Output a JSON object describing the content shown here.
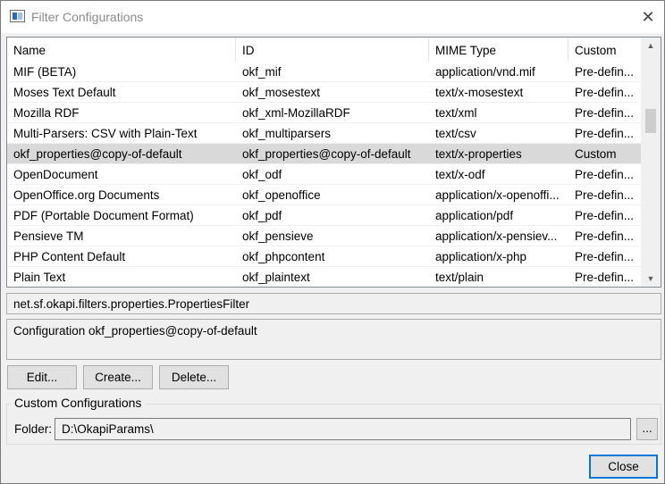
{
  "window": {
    "title": "Filter Configurations",
    "close_glyph": "✕"
  },
  "table": {
    "columns": [
      "Name",
      "ID",
      "MIME Type",
      "Custom"
    ],
    "rows": [
      {
        "name": "MIF (BETA)",
        "id": "okf_mif",
        "mime": "application/vnd.mif",
        "custom": "Pre-defin..."
      },
      {
        "name": "Moses Text Default",
        "id": "okf_mosestext",
        "mime": "text/x-mosestext",
        "custom": "Pre-defin..."
      },
      {
        "name": "Mozilla RDF",
        "id": "okf_xml-MozillaRDF",
        "mime": "text/xml",
        "custom": "Pre-defin..."
      },
      {
        "name": "Multi-Parsers: CSV with Plain-Text",
        "id": "okf_multiparsers",
        "mime": "text/csv",
        "custom": "Pre-defin..."
      },
      {
        "name": "okf_properties@copy-of-default",
        "id": "okf_properties@copy-of-default",
        "mime": "text/x-properties",
        "custom": "Custom",
        "selected": true
      },
      {
        "name": "OpenDocument",
        "id": "okf_odf",
        "mime": "text/x-odf",
        "custom": "Pre-defin..."
      },
      {
        "name": "OpenOffice.org Documents",
        "id": "okf_openoffice",
        "mime": "application/x-openoffi...",
        "custom": "Pre-defin..."
      },
      {
        "name": "PDF (Portable Document Format)",
        "id": "okf_pdf",
        "mime": "application/pdf",
        "custom": "Pre-defin..."
      },
      {
        "name": "Pensieve TM",
        "id": "okf_pensieve",
        "mime": "application/x-pensiev...",
        "custom": "Pre-defin..."
      },
      {
        "name": "PHP Content Default",
        "id": "okf_phpcontent",
        "mime": "application/x-php",
        "custom": "Pre-defin..."
      },
      {
        "name": "Plain Text",
        "id": "okf_plaintext",
        "mime": "text/plain",
        "custom": "Pre-defin..."
      }
    ]
  },
  "scrollbar": {
    "up_glyph": "▲",
    "down_glyph": "▼"
  },
  "filter_class": "net.sf.okapi.filters.properties.PropertiesFilter",
  "description": "Configuration okf_properties@copy-of-default",
  "buttons": {
    "edit": "Edit...",
    "create": "Create...",
    "delete": "Delete...",
    "close": "Close"
  },
  "custom_group": {
    "label": "Custom Configurations",
    "folder_label": "Folder:",
    "folder_value": "D:\\OkapiParams\\",
    "browse_label": "..."
  },
  "colors": {
    "selection": "#d9d9d9",
    "focus_border": "#0078d7"
  }
}
